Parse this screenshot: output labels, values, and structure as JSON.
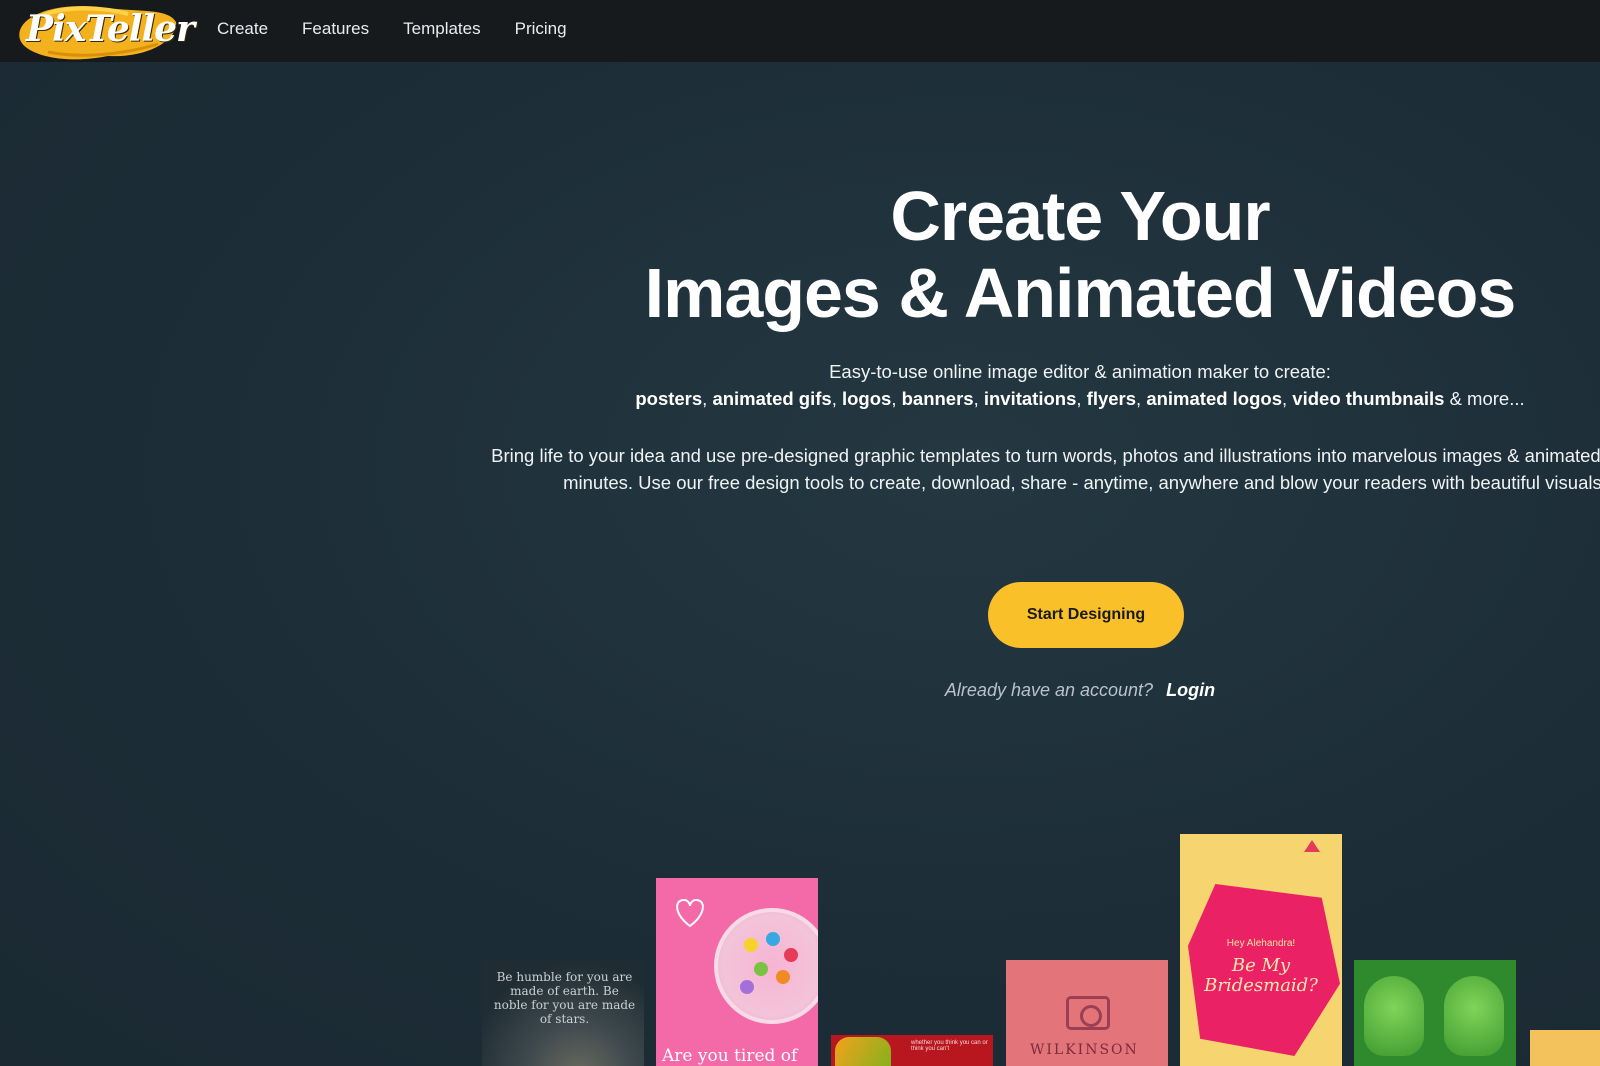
{
  "brand": {
    "name": "PixTeller",
    "accent": "#f9c02a"
  },
  "nav": {
    "items": [
      "Create",
      "Features",
      "Templates",
      "Pricing"
    ]
  },
  "hero": {
    "title_line1": "Create Your",
    "title_line2": "Images & Animated Videos",
    "subtitle": "Easy-to-use online image editor & animation maker to create:",
    "formats": [
      "posters",
      "animated gifs",
      "logos",
      "banners",
      "invitations",
      "flyers",
      "animated logos",
      "video thumbnails"
    ],
    "formats_suffix": "& more...",
    "description": "Bring life to your idea and use pre-designed graphic templates to turn words, photos and illustrations into marvelous images & animated videos in minutes. Use our free design tools to create, download, share - anytime, anywhere and blow your readers with beautiful visuals.",
    "cta_label": "Start Designing",
    "account_prompt": "Already have an account?",
    "login_label": "Login"
  },
  "templates": {
    "t1_text": "Be humble for you are made of earth. Be noble for you are made of stars.",
    "t2_caption": "Are you tired of",
    "t3_small": "whether you think you can or think you can't",
    "t4_name": "WILKINSON",
    "t5_hey": "Hey Alehandra!",
    "t5_be": "Be My Bridesmaid?"
  }
}
